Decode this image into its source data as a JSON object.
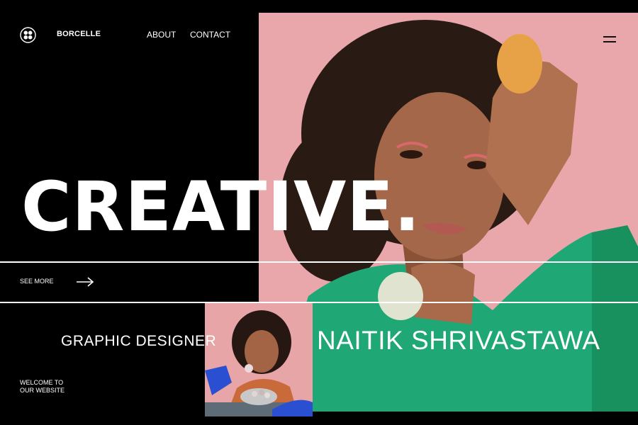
{
  "header": {
    "brand": "BORCELLE",
    "nav": [
      {
        "label": "ABOUT"
      },
      {
        "label": "CONTACT"
      }
    ]
  },
  "hero": {
    "headline": "CREATIVE.",
    "see_more": "SEE MORE"
  },
  "profile": {
    "role": "GRAPHIC DESIGNER",
    "name": "NAITIK SHRIVASTAWA"
  },
  "footer": {
    "welcome_line1": "WELCOME TO",
    "welcome_line2": "OUR WEBSITE"
  },
  "colors": {
    "background": "#000000",
    "photo_pink": "#e9a7ab",
    "shirt_green": "#1fa776",
    "text": "#ffffff"
  }
}
